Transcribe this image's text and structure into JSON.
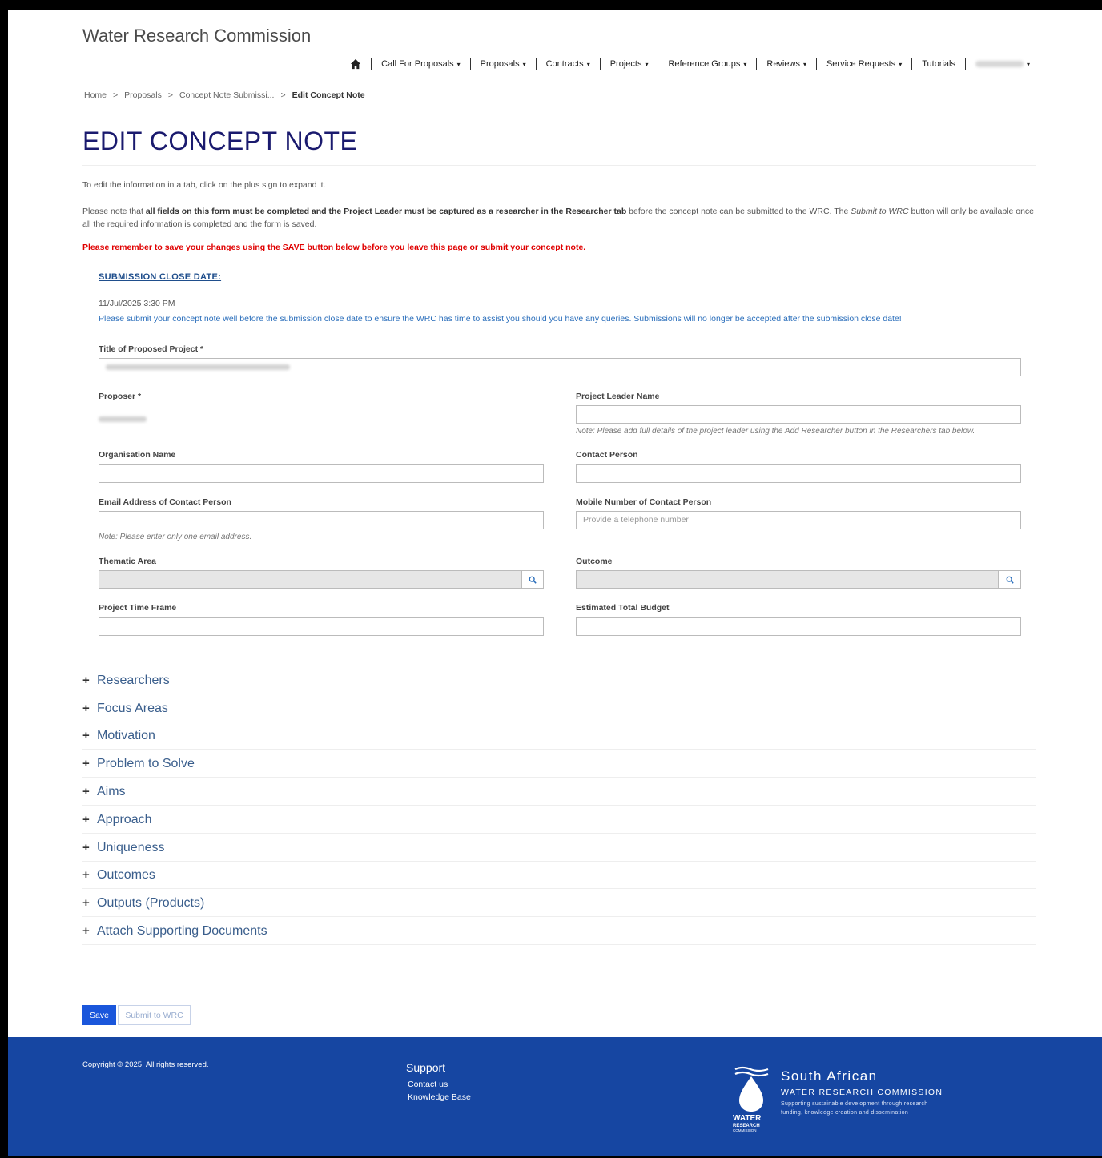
{
  "app": {
    "title": "Water Research Commission"
  },
  "nav": {
    "items": [
      {
        "label": "Call For Proposals",
        "caret": "▾"
      },
      {
        "label": "Proposals",
        "caret": "▾"
      },
      {
        "label": "Contracts",
        "caret": "▾"
      },
      {
        "label": "Projects",
        "caret": "▾"
      },
      {
        "label": "Reference Groups",
        "caret": "▾"
      },
      {
        "label": "Reviews",
        "caret": "▾"
      },
      {
        "label": "Service Requests",
        "caret": "▾"
      }
    ],
    "tutorials": "Tutorials",
    "user_caret": "▾"
  },
  "breadcrumb": {
    "home": "Home",
    "proposals": "Proposals",
    "submission": "Concept Note Submissi...",
    "current": "Edit Concept Note",
    "sep": ">"
  },
  "page": {
    "title": "EDIT CONCEPT NOTE",
    "intro": "To edit the information in a tab, click on the plus sign to expand it.",
    "note_prefix": "Please note that ",
    "note_strong": "all fields on this form must be completed and the Project Leader must be captured as a researcher in the Researcher tab",
    "note_mid": " before the concept note can be submitted to the WRC. The ",
    "note_em": "Submit to WRC",
    "note_suffix": " button will only be available once all the required information is completed and the form is saved.",
    "warning": "Please remember to save your changes using the SAVE button below before you leave this page or submit your concept note."
  },
  "submission": {
    "label": "SUBMISSION CLOSE DATE:",
    "date": "11/Jul/2025 3:30 PM",
    "note": "Please submit your concept note well before the submission close date to ensure the WRC has time to assist you should you have any queries. Submissions will no longer be accepted after the submission close date!"
  },
  "form": {
    "title_label": "Title of Proposed Project",
    "required_mark": " *",
    "proposer_label": "Proposer",
    "project_leader_label": "Project Leader Name",
    "project_leader_hint": "Note: Please add full details of the project leader using the Add Researcher button in the Researchers tab below.",
    "organisation_label": "Organisation Name",
    "contact_label": "Contact Person",
    "email_label": "Email Address of Contact Person",
    "email_hint": "Note: Please enter only one email address.",
    "mobile_label": "Mobile Number of Contact Person",
    "mobile_placeholder": "Provide a telephone number",
    "thematic_label": "Thematic Area",
    "outcome_label": "Outcome",
    "timeframe_label": "Project Time Frame",
    "budget_label": "Estimated Total Budget"
  },
  "sections": [
    "Researchers",
    "Focus Areas",
    "Motivation",
    "Problem to Solve",
    "Aims",
    "Approach",
    "Uniqueness",
    "Outcomes",
    "Outputs (Products)",
    "Attach Supporting Documents"
  ],
  "section_plus": "+",
  "buttons": {
    "save": "Save",
    "submit": "Submit to WRC"
  },
  "footer": {
    "copyright": "Copyright © 2025. All rights reserved.",
    "support_heading": "Support",
    "contact_us": "Contact us",
    "knowledge_base": "Knowledge Base",
    "logo_title": "South African",
    "logo_sub": "WATER RESEARCH COMMISSION",
    "logo_tag1": "Supporting sustainable development through research",
    "logo_tag2": "funding, knowledge creation and dissemination",
    "logo_mark_1": "WATER",
    "logo_mark_2": "RESEARCH",
    "logo_mark_3": "COMMISSION"
  },
  "colors": {
    "title": "#1a1a6e",
    "warning": "#e00000",
    "link": "#1f4e8c",
    "footer": "#1646a2",
    "save_button": "#1a56db"
  }
}
